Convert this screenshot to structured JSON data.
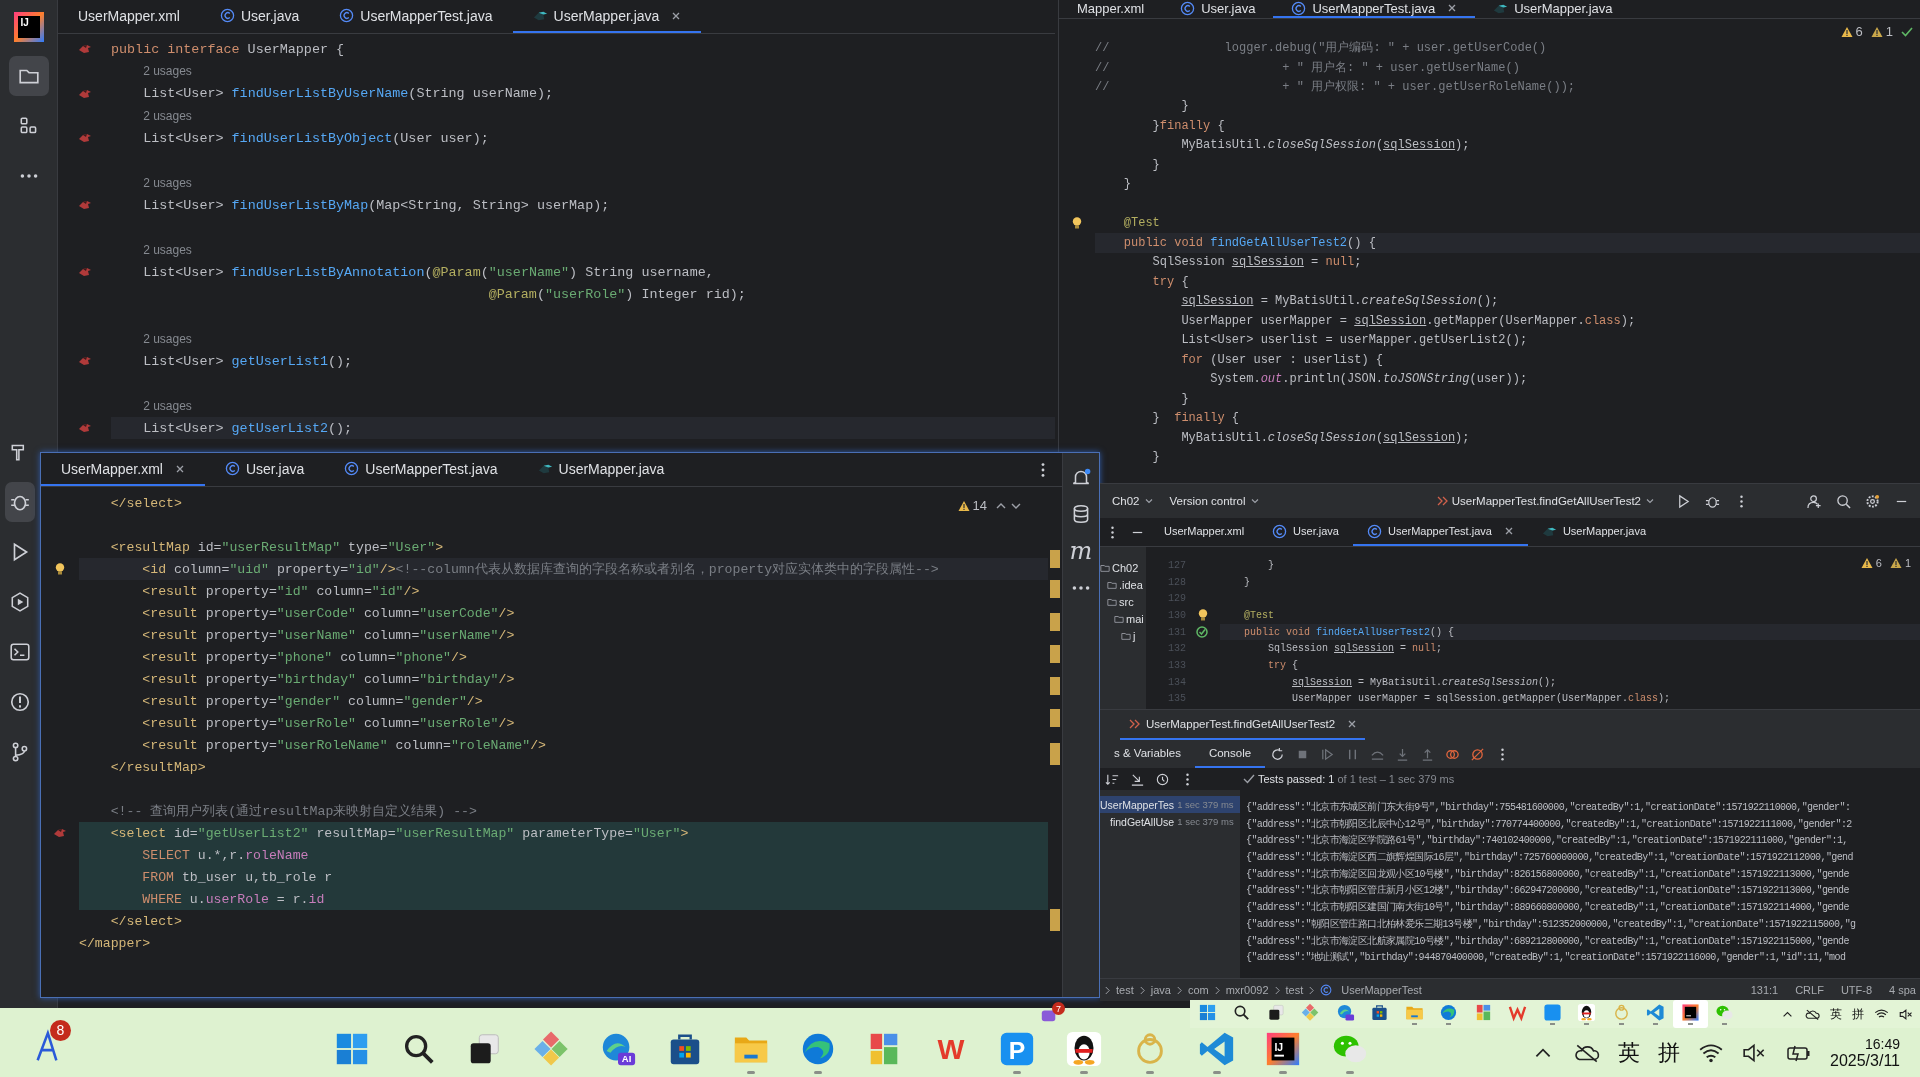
{
  "ide_main": {
    "logo": {
      "label": "IJ"
    },
    "toolbar": [
      {
        "kind": "project",
        "selected": true
      },
      {
        "kind": "structure",
        "selected": false
      },
      {
        "kind": "more",
        "selected": false
      }
    ],
    "toolbar_lower": [
      {
        "kind": "build",
        "selected": false
      },
      {
        "kind": "debug",
        "selected": true
      },
      {
        "kind": "run",
        "selected": false
      },
      {
        "kind": "services",
        "selected": false
      },
      {
        "kind": "terminal",
        "selected": false
      },
      {
        "kind": "problems",
        "selected": false
      },
      {
        "kind": "git",
        "selected": false
      }
    ],
    "editor": {
      "tabs": [
        {
          "label": "UserMapper.xml",
          "selected": false
        },
        {
          "label": "User.java",
          "kind": "class",
          "selected": false
        },
        {
          "label": "UserMapperTest.java",
          "kind": "class",
          "selected": false
        },
        {
          "label": "UserMapper.java",
          "kind": "mapper",
          "selected": true
        }
      ],
      "lines": [
        {
          "kind": "code",
          "current": false,
          "gutter": {
            "kind": "mapper"
          },
          "parts": [
            {
              "kind": "keyword",
              "text": "public interface "
            },
            {
              "kind": "plain",
              "text": "UserMapper {"
            }
          ]
        },
        {
          "kind": "hint",
          "text": "2 usages"
        },
        {
          "kind": "code",
          "current": false,
          "gutter": {
            "kind": "mapper"
          },
          "parts": [
            {
              "kind": "plain",
              "text": "    List<User> "
            },
            {
              "kind": "method",
              "text": "findUserListByUserName"
            },
            {
              "kind": "plain",
              "text": "(String userName);"
            }
          ]
        },
        {
          "kind": "hint",
          "text": "2 usages"
        },
        {
          "kind": "code",
          "current": false,
          "gutter": {
            "kind": "mapper"
          },
          "parts": [
            {
              "kind": "plain",
              "text": "    List<User> "
            },
            {
              "kind": "method",
              "text": "findUserListByObject"
            },
            {
              "kind": "plain",
              "text": "(User user);"
            }
          ]
        },
        {
          "kind": "blank"
        },
        {
          "kind": "hint",
          "text": "2 usages"
        },
        {
          "kind": "code",
          "current": false,
          "gutter": {
            "kind": "mapper"
          },
          "parts": [
            {
              "kind": "plain",
              "text": "    List<User> "
            },
            {
              "kind": "method",
              "text": "findUserListByMap"
            },
            {
              "kind": "plain",
              "text": "(Map<String, String> userMap);"
            }
          ]
        },
        {
          "kind": "blank"
        },
        {
          "kind": "hint",
          "text": "2 usages"
        },
        {
          "kind": "code",
          "current": false,
          "gutter": {
            "kind": "mapper"
          },
          "parts": [
            {
              "kind": "plain",
              "text": "    List<User> "
            },
            {
              "kind": "method",
              "text": "findUserListByAnnotation"
            },
            {
              "kind": "plain",
              "text": "("
            },
            {
              "kind": "annotation",
              "text": "@Param"
            },
            {
              "kind": "plain",
              "text": "("
            },
            {
              "kind": "string",
              "text": "\"userName\""
            },
            {
              "kind": "plain",
              "text": ") String username,"
            }
          ]
        },
        {
          "kind": "code",
          "current": false,
          "parts": [
            {
              "kind": "annotation",
              "text": "                                               @Param"
            },
            {
              "kind": "plain",
              "text": "("
            },
            {
              "kind": "string",
              "text": "\"userRole\""
            },
            {
              "kind": "plain",
              "text": ") Integer rid);"
            }
          ]
        },
        {
          "kind": "blank"
        },
        {
          "kind": "hint",
          "text": "2 usages"
        },
        {
          "kind": "code",
          "current": false,
          "gutter": {
            "kind": "mapper"
          },
          "parts": [
            {
              "kind": "plain",
              "text": "    List<User> "
            },
            {
              "kind": "method",
              "text": "getUserList1"
            },
            {
              "kind": "plain",
              "text": "();"
            }
          ]
        },
        {
          "kind": "blank"
        },
        {
          "kind": "hint",
          "text": "2 usages"
        },
        {
          "kind": "code",
          "current": true,
          "gutter": {
            "kind": "mapper"
          },
          "parts": [
            {
              "kind": "plain",
              "text": "    List<User> "
            },
            {
              "kind": "method",
              "text": "getUserList2"
            },
            {
              "kind": "plain",
              "text": "();"
            }
          ]
        }
      ]
    }
  },
  "editor_right": {
    "tabs": [
      {
        "label": "Mapper.xml",
        "selected": false
      },
      {
        "label": "User.java",
        "kind": "class",
        "selected": false
      },
      {
        "label": "UserMapperTest.java",
        "kind": "class",
        "selected": true
      },
      {
        "label": "UserMapper.java",
        "kind": "mapper",
        "selected": false
      }
    ],
    "inspections": {
      "warnings": "6",
      "weak_warnings": "1"
    },
    "lines": [
      {
        "kind": "code",
        "current": false,
        "parts": [
          {
            "kind": "comment",
            "text": "//                logger.debug(\"用户编码: \" + user.getUserCode()"
          }
        ]
      },
      {
        "kind": "code",
        "current": false,
        "parts": [
          {
            "kind": "comment",
            "text": "//                        + \" 用户名: \" + user.getUserName()"
          }
        ]
      },
      {
        "kind": "code",
        "current": false,
        "parts": [
          {
            "kind": "comment",
            "text": "//                        + \" 用户权限: \" + user.getUserRoleName());"
          }
        ]
      },
      {
        "kind": "code",
        "current": false,
        "parts": [
          {
            "kind": "plain",
            "text": "            }"
          }
        ]
      },
      {
        "kind": "code",
        "current": false,
        "parts": [
          {
            "kind": "plain",
            "text": "        }"
          },
          {
            "kind": "keyword",
            "text": "finally"
          },
          {
            "kind": "plain",
            "text": " {"
          }
        ]
      },
      {
        "kind": "code",
        "current": false,
        "parts": [
          {
            "kind": "plain",
            "text": "            MyBatisUtil."
          },
          {
            "kind": "static",
            "text": "closeSqlSession"
          },
          {
            "kind": "plain",
            "text": "("
          },
          {
            "kind": "var",
            "text": "sqlSession"
          },
          {
            "kind": "plain",
            "text": ");"
          }
        ]
      },
      {
        "kind": "code",
        "current": false,
        "parts": [
          {
            "kind": "plain",
            "text": "        }"
          }
        ]
      },
      {
        "kind": "code",
        "current": false,
        "parts": [
          {
            "kind": "plain",
            "text": "    }"
          }
        ]
      },
      {
        "kind": "blank"
      },
      {
        "kind": "code",
        "current": false,
        "gutter": {
          "kind": "bulb"
        },
        "parts": [
          {
            "kind": "annotation",
            "text": "    @Test"
          }
        ]
      },
      {
        "kind": "code",
        "current": true,
        "parts": [
          {
            "kind": "keyword",
            "text": "    public void "
          },
          {
            "kind": "method",
            "text": "findGetAllUserTest2"
          },
          {
            "kind": "plain",
            "text": "() {"
          }
        ]
      },
      {
        "kind": "code",
        "current": false,
        "parts": [
          {
            "kind": "plain",
            "text": "        SqlSession "
          },
          {
            "kind": "var",
            "text": "sqlSession"
          },
          {
            "kind": "plain",
            "text": " = "
          },
          {
            "kind": "keyword",
            "text": "null"
          },
          {
            "kind": "plain",
            "text": ";"
          }
        ]
      },
      {
        "kind": "code",
        "current": false,
        "parts": [
          {
            "kind": "keyword",
            "text": "        try"
          },
          {
            "kind": "plain",
            "text": " {"
          }
        ]
      },
      {
        "kind": "code",
        "current": false,
        "parts": [
          {
            "kind": "var",
            "text": "            sqlSession"
          },
          {
            "kind": "plain",
            "text": " = MyBatisUtil."
          },
          {
            "kind": "static",
            "text": "createSqlSession"
          },
          {
            "kind": "plain",
            "text": "();"
          }
        ]
      },
      {
        "kind": "code",
        "current": false,
        "parts": [
          {
            "kind": "plain",
            "text": "            UserMapper userMapper = "
          },
          {
            "kind": "var",
            "text": "sqlSession"
          },
          {
            "kind": "plain",
            "text": ".getMapper(UserMapper."
          },
          {
            "kind": "keyword",
            "text": "class"
          },
          {
            "kind": "plain",
            "text": ");"
          }
        ]
      },
      {
        "kind": "code",
        "current": false,
        "parts": [
          {
            "kind": "plain",
            "text": "            List<User> userlist = userMapper.getUserList2();"
          }
        ]
      },
      {
        "kind": "code",
        "current": false,
        "parts": [
          {
            "kind": "keyword",
            "text": "            for"
          },
          {
            "kind": "plain",
            "text": " (User user : userlist) {"
          }
        ]
      },
      {
        "kind": "code",
        "current": false,
        "parts": [
          {
            "kind": "plain",
            "text": "                System."
          },
          {
            "kind": "static_field",
            "text": "out"
          },
          {
            "kind": "plain",
            "text": ".println(JSON."
          },
          {
            "kind": "static",
            "text": "toJSONString"
          },
          {
            "kind": "plain",
            "text": "(user));"
          }
        ]
      },
      {
        "kind": "code",
        "current": false,
        "parts": [
          {
            "kind": "plain",
            "text": "            }"
          }
        ]
      },
      {
        "kind": "code",
        "current": false,
        "parts": [
          {
            "kind": "plain",
            "text": "        }  "
          },
          {
            "kind": "keyword",
            "text": "finally"
          },
          {
            "kind": "plain",
            "text": " {"
          }
        ]
      },
      {
        "kind": "code",
        "current": false,
        "parts": [
          {
            "kind": "plain",
            "text": "            MyBatisUtil."
          },
          {
            "kind": "static",
            "text": "closeSqlSession"
          },
          {
            "kind": "plain",
            "text": "("
          },
          {
            "kind": "var",
            "text": "sqlSession"
          },
          {
            "kind": "plain",
            "text": ");"
          }
        ]
      },
      {
        "kind": "code",
        "current": false,
        "parts": [
          {
            "kind": "plain",
            "text": "        }"
          }
        ]
      }
    ]
  },
  "xml_window": {
    "tabs": [
      {
        "label": "UserMapper.xml",
        "selected": true
      },
      {
        "label": "User.java",
        "kind": "class",
        "selected": false
      },
      {
        "label": "UserMapperTest.java",
        "kind": "class",
        "selected": false
      },
      {
        "label": "UserMapper.java",
        "kind": "mapper",
        "selected": false
      }
    ],
    "inspections": {
      "warnings": "14"
    },
    "side_toolbar": {
      "maven_label": "m"
    },
    "lines": [
      {
        "kind": "code",
        "current": false,
        "injected": false,
        "parts": [
          {
            "kind": "tag",
            "text": "    </select>"
          }
        ]
      },
      {
        "kind": "blank"
      },
      {
        "kind": "code",
        "current": false,
        "injected": false,
        "parts": [
          {
            "kind": "tag",
            "text": "    <resultMap "
          },
          {
            "kind": "plain",
            "text": "id="
          },
          {
            "kind": "string",
            "text": "\"userResultMap\""
          },
          {
            "kind": "plain",
            "text": " type="
          },
          {
            "kind": "string",
            "text": "\"User\""
          },
          {
            "kind": "tag",
            "text": ">"
          }
        ]
      },
      {
        "kind": "code",
        "current": true,
        "injected": false,
        "gutter": {
          "kind": "bulb"
        },
        "parts": [
          {
            "kind": "tag",
            "text": "        <id "
          },
          {
            "kind": "plain",
            "text": "column="
          },
          {
            "kind": "string",
            "text": "\"uid\""
          },
          {
            "kind": "plain",
            "text": " property="
          },
          {
            "kind": "string",
            "text": "\"id\""
          },
          {
            "kind": "tag",
            "text": "/>"
          },
          {
            "kind": "comment",
            "text": "<!--column代表从数据库查询的字段名称或者别名，property对应实体类中的字段属性-->"
          }
        ]
      },
      {
        "kind": "code",
        "current": false,
        "injected": false,
        "parts": [
          {
            "kind": "tag",
            "text": "        <result "
          },
          {
            "kind": "plain",
            "text": "property="
          },
          {
            "kind": "string",
            "text": "\"id\""
          },
          {
            "kind": "plain",
            "text": " column="
          },
          {
            "kind": "string",
            "text": "\"id\""
          },
          {
            "kind": "tag",
            "text": "/>"
          }
        ]
      },
      {
        "kind": "code",
        "current": false,
        "injected": false,
        "parts": [
          {
            "kind": "tag",
            "text": "        <result "
          },
          {
            "kind": "plain",
            "text": "property="
          },
          {
            "kind": "string",
            "text": "\"userCode\""
          },
          {
            "kind": "plain",
            "text": " column="
          },
          {
            "kind": "string",
            "text": "\"userCode\""
          },
          {
            "kind": "tag",
            "text": "/>"
          }
        ]
      },
      {
        "kind": "code",
        "current": false,
        "injected": false,
        "parts": [
          {
            "kind": "tag",
            "text": "        <result "
          },
          {
            "kind": "plain",
            "text": "property="
          },
          {
            "kind": "string",
            "text": "\"userName\""
          },
          {
            "kind": "plain",
            "text": " column="
          },
          {
            "kind": "string",
            "text": "\"userName\""
          },
          {
            "kind": "tag",
            "text": "/>"
          }
        ]
      },
      {
        "kind": "code",
        "current": false,
        "injected": false,
        "parts": [
          {
            "kind": "tag",
            "text": "        <result "
          },
          {
            "kind": "plain",
            "text": "property="
          },
          {
            "kind": "string",
            "text": "\"phone\""
          },
          {
            "kind": "plain",
            "text": " column="
          },
          {
            "kind": "string",
            "text": "\"phone\""
          },
          {
            "kind": "tag",
            "text": "/>"
          }
        ]
      },
      {
        "kind": "code",
        "current": false,
        "injected": false,
        "parts": [
          {
            "kind": "tag",
            "text": "        <result "
          },
          {
            "kind": "plain",
            "text": "property="
          },
          {
            "kind": "string",
            "text": "\"birthday\""
          },
          {
            "kind": "plain",
            "text": " column="
          },
          {
            "kind": "string",
            "text": "\"birthday\""
          },
          {
            "kind": "tag",
            "text": "/>"
          }
        ]
      },
      {
        "kind": "code",
        "current": false,
        "injected": false,
        "parts": [
          {
            "kind": "tag",
            "text": "        <result "
          },
          {
            "kind": "plain",
            "text": "property="
          },
          {
            "kind": "string",
            "text": "\"gender\""
          },
          {
            "kind": "plain",
            "text": " column="
          },
          {
            "kind": "string",
            "text": "\"gender\""
          },
          {
            "kind": "tag",
            "text": "/>"
          }
        ]
      },
      {
        "kind": "code",
        "current": false,
        "injected": false,
        "parts": [
          {
            "kind": "tag",
            "text": "        <result "
          },
          {
            "kind": "plain",
            "text": "property="
          },
          {
            "kind": "string",
            "text": "\"userRole\""
          },
          {
            "kind": "plain",
            "text": " column="
          },
          {
            "kind": "string",
            "text": "\"userRole\""
          },
          {
            "kind": "tag",
            "text": "/>"
          }
        ]
      },
      {
        "kind": "code",
        "current": false,
        "injected": false,
        "parts": [
          {
            "kind": "tag",
            "text": "        <result "
          },
          {
            "kind": "plain",
            "text": "property="
          },
          {
            "kind": "string",
            "text": "\"userRoleName\""
          },
          {
            "kind": "plain",
            "text": " column="
          },
          {
            "kind": "string",
            "text": "\"roleName\""
          },
          {
            "kind": "tag",
            "text": "/>"
          }
        ]
      },
      {
        "kind": "code",
        "current": false,
        "injected": false,
        "parts": [
          {
            "kind": "tag",
            "text": "    </resultMap>"
          }
        ]
      },
      {
        "kind": "blank"
      },
      {
        "kind": "code",
        "current": false,
        "injected": false,
        "parts": [
          {
            "kind": "comment",
            "text": "    <!-- 查询用户列表(通过resultMap来映射自定义结果) -->"
          }
        ]
      },
      {
        "kind": "code",
        "current": false,
        "injected": true,
        "gutter": {
          "kind": "mapper"
        },
        "parts": [
          {
            "kind": "tag",
            "text": "    <select "
          },
          {
            "kind": "plain",
            "text": "id="
          },
          {
            "kind": "string",
            "text": "\"getUserList2\""
          },
          {
            "kind": "plain",
            "text": " resultMap="
          },
          {
            "kind": "string",
            "text": "\"userResultMap\""
          },
          {
            "kind": "plain",
            "text": " parameterType="
          },
          {
            "kind": "string",
            "text": "\"User\""
          },
          {
            "kind": "tag",
            "text": ">"
          }
        ]
      },
      {
        "kind": "code",
        "current": false,
        "injected": true,
        "parts": [
          {
            "kind": "keyword",
            "text": "        SELECT "
          },
          {
            "kind": "plain",
            "text": "u.*,r."
          },
          {
            "kind": "field",
            "text": "roleName"
          }
        ]
      },
      {
        "kind": "code",
        "current": false,
        "injected": true,
        "parts": [
          {
            "kind": "keyword",
            "text": "        FROM "
          },
          {
            "kind": "plain",
            "text": "tb_user u,tb_role r"
          }
        ]
      },
      {
        "kind": "code",
        "current": false,
        "injected": true,
        "parts": [
          {
            "kind": "keyword",
            "text": "        WHERE "
          },
          {
            "kind": "plain",
            "text": "u."
          },
          {
            "kind": "field",
            "text": "userRole"
          },
          {
            "kind": "plain",
            "text": " = r."
          },
          {
            "kind": "field",
            "text": "id"
          }
        ]
      },
      {
        "kind": "code",
        "current": false,
        "injected": false,
        "parts": [
          {
            "kind": "tag",
            "text": "    </select>"
          }
        ]
      },
      {
        "kind": "code",
        "current": false,
        "injected": false,
        "parts": [
          {
            "kind": "tag",
            "text": "</mapper>"
          }
        ]
      }
    ]
  },
  "ide_second": {
    "toolbar": {
      "project": "Ch02",
      "vcs": "Version control",
      "run_config": "UserMapperTest.findGetAllUserTest2"
    },
    "tabs": [
      {
        "label": "UserMapper.xml",
        "selected": false
      },
      {
        "label": "User.java",
        "kind": "class",
        "selected": false
      },
      {
        "label": "UserMapperTest.java",
        "kind": "class",
        "selected": true
      },
      {
        "label": "UserMapper.java",
        "kind": "mapper",
        "selected": false
      }
    ],
    "project_tree": [
      {
        "label": "Ch02",
        "children": [
          {
            "label": ".idea"
          },
          {
            "label": "src",
            "children": [
              {
                "label": "mai",
                "children": [
                  {
                    "label": "j"
                  }
                ]
              }
            ]
          }
        ]
      }
    ],
    "inspections": {
      "warnings": "6",
      "weak_warnings": "1"
    },
    "lines": [
      {
        "kind": "code",
        "number": "127",
        "current": false,
        "parts": [
          {
            "kind": "plain",
            "text": "        }"
          }
        ]
      },
      {
        "kind": "code",
        "number": "128",
        "current": false,
        "parts": [
          {
            "kind": "plain",
            "text": "    }"
          }
        ]
      },
      {
        "kind": "blank",
        "number": "129"
      },
      {
        "kind": "code",
        "number": "130",
        "current": false,
        "gutter": {
          "kind": "bulb"
        },
        "parts": [
          {
            "kind": "annotation",
            "text": "    @Test"
          }
        ]
      },
      {
        "kind": "code",
        "number": "131",
        "current": true,
        "gutter": {
          "kind": "test_passed"
        },
        "parts": [
          {
            "kind": "keyword",
            "text": "    public void "
          },
          {
            "kind": "method",
            "text": "findGetAllUserTest2"
          },
          {
            "kind": "plain",
            "text": "() {"
          }
        ]
      },
      {
        "kind": "code",
        "number": "132",
        "current": false,
        "parts": [
          {
            "kind": "plain",
            "text": "        SqlSession "
          },
          {
            "kind": "var",
            "text": "sqlSession"
          },
          {
            "kind": "plain",
            "text": " = "
          },
          {
            "kind": "keyword",
            "text": "null"
          },
          {
            "kind": "plain",
            "text": ";"
          }
        ]
      },
      {
        "kind": "code",
        "number": "133",
        "current": false,
        "parts": [
          {
            "kind": "keyword",
            "text": "        try"
          },
          {
            "kind": "plain",
            "text": " {"
          }
        ]
      },
      {
        "kind": "code",
        "number": "134",
        "current": false,
        "parts": [
          {
            "kind": "var",
            "text": "            sqlSession"
          },
          {
            "kind": "plain",
            "text": " = MyBatisUtil."
          },
          {
            "kind": "static",
            "text": "createSqlSession"
          },
          {
            "kind": "plain",
            "text": "();"
          }
        ]
      },
      {
        "kind": "code",
        "number": "135",
        "current": false,
        "parts": [
          {
            "kind": "plain",
            "text": "            UserMapper userMapper = sqlSession.getMapper(UserMapper."
          },
          {
            "kind": "keyword",
            "text": "class"
          },
          {
            "kind": "plain",
            "text": ");"
          }
        ]
      }
    ],
    "run_panel": {
      "run_tab": "UserMapperTest.findGetAllUserTest2",
      "tabs": [
        {
          "label": "s & Variables",
          "selected": false
        },
        {
          "label": "Console",
          "selected": true
        }
      ],
      "summary": "Tests passed: 1",
      "summary_detail": "of 1 test – 1 sec 379 ms",
      "tests": [
        {
          "label": "UserMapperTes",
          "time": "1 sec 379 ms",
          "selected": true,
          "children": [
            {
              "label": "findGetAllUse",
              "time": "1 sec 379 ms",
              "selected": false
            }
          ]
        }
      ],
      "console": [
        "{\"address\":\"北京市东城区前门东大街9号\",\"birthday\":755481600000,\"createdBy\":1,\"creationDate\":1571922110000,\"gender\":",
        "{\"address\":\"北京市朝阳区北辰中心12号\",\"birthday\":770774400000,\"createdBy\":1,\"creationDate\":1571922111000,\"gender\":2",
        "{\"address\":\"北京市海淀区学院路61号\",\"birthday\":740102400000,\"createdBy\":1,\"creationDate\":1571922111000,\"gender\":1,",
        "{\"address\":\"北京市海淀区西二旗辉煌国际16层\",\"birthday\":725760000000,\"createdBy\":1,\"creationDate\":1571922112000,\"gend",
        "{\"address\":\"北京市海淀区回龙观小区10号楼\",\"birthday\":826156800000,\"createdBy\":1,\"creationDate\":1571922113000,\"gende",
        "{\"address\":\"北京市朝阳区管庄新月小区12楼\",\"birthday\":662947200000,\"createdBy\":1,\"creationDate\":1571922113000,\"gende",
        "{\"address\":\"北京市朝阳区建国门南大街10号\",\"birthday\":889660800000,\"createdBy\":1,\"creationDate\":1571922114000,\"gende",
        "{\"address\":\"朝阳区管庄路口北柏林爱乐三期13号楼\",\"birthday\":512352000000,\"createdBy\":1,\"creationDate\":1571922115000,\"g",
        "{\"address\":\"北京市海淀区北航家属院10号楼\",\"birthday\":689212800000,\"createdBy\":1,\"creationDate\":1571922115000,\"gende",
        "{\"address\":\"地址测试\",\"birthday\":944870400000,\"createdBy\":1,\"creationDate\":1571922116000,\"gender\":1,\"id\":11,\"mod"
      ]
    },
    "status_bar": {
      "breadcrumbs": [
        "test",
        "java",
        "com",
        "mxr0092",
        "test",
        "UserMapperTest"
      ],
      "items": [
        "131:1",
        "CRLF",
        "UTF-8",
        "4 spa"
      ]
    }
  },
  "mini_taskbar": {
    "apps": [
      {
        "kind": "start",
        "running": false
      },
      {
        "kind": "search",
        "running": false
      },
      {
        "kind": "task_view",
        "running": false
      },
      {
        "kind": "colorful_app",
        "running": false
      },
      {
        "kind": "edge_ai",
        "running": false
      },
      {
        "kind": "store",
        "running": false
      },
      {
        "kind": "files",
        "running": true
      },
      {
        "kind": "edge",
        "running": true
      },
      {
        "kind": "blocks_app",
        "running": false
      },
      {
        "kind": "wps",
        "running": false
      },
      {
        "kind": "p_app",
        "running": true
      },
      {
        "kind": "qq",
        "running": true
      },
      {
        "kind": "ring_app",
        "running": true
      },
      {
        "kind": "vscode",
        "running": true
      },
      {
        "kind": "intellij",
        "running": true
      },
      {
        "kind": "wechat",
        "running": true
      }
    ],
    "tray": {
      "ime_lang": "英",
      "ime_mode": "拼"
    }
  },
  "notice": {
    "badge": "7"
  },
  "taskbar": {
    "widget": {
      "badge": "8"
    },
    "apps": [
      {
        "kind": "start",
        "running": false
      },
      {
        "kind": "search",
        "running": false
      },
      {
        "kind": "task_view",
        "running": false
      },
      {
        "kind": "colorful_app",
        "running": false
      },
      {
        "kind": "edge_ai",
        "label": "AI",
        "running": false
      },
      {
        "kind": "store",
        "running": false
      },
      {
        "kind": "files",
        "running": true
      },
      {
        "kind": "edge",
        "running": true
      },
      {
        "kind": "blocks_app",
        "running": false
      },
      {
        "kind": "wps",
        "label": "W",
        "running": false
      },
      {
        "kind": "p_app",
        "label": "P",
        "running": true
      },
      {
        "kind": "qq",
        "running": true
      },
      {
        "kind": "ring_app",
        "running": true
      },
      {
        "kind": "vscode",
        "running": true
      },
      {
        "kind": "intellij",
        "label": "IJ",
        "running": true
      },
      {
        "kind": "wechat",
        "running": true
      }
    ],
    "tray": {
      "ime_lang": "英",
      "ime_mode": "拼",
      "time": "16:49",
      "date": "2025/3/11"
    }
  }
}
